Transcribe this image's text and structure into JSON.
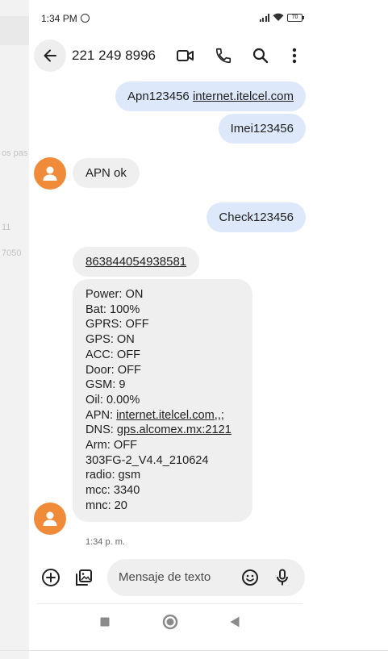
{
  "status": {
    "time": "1:34 PM",
    "battery": "70"
  },
  "header": {
    "contact": "221 249 8996"
  },
  "messages": [
    {
      "dir": "out",
      "prefix": "Apn123456 ",
      "link": "internet.itelcel.com"
    },
    {
      "dir": "out",
      "text": "Imei123456"
    },
    {
      "dir": "in",
      "text": "APN ok"
    },
    {
      "dir": "out",
      "text": "Check123456"
    },
    {
      "dir": "in",
      "link": "863844054938581"
    }
  ],
  "status_report": {
    "lines_a": "Power: ON\nBat: 100%\nGPRS: OFF\nGPS: ON\nACC: OFF\nDoor: OFF\nGSM: 9\nOil: 0.00%",
    "apn_label": "APN: ",
    "apn_link": "internet.itelcel.com,,;",
    "dns_label": "DNS: ",
    "dns_link": "gps.alcomex.mx:2121",
    "lines_b": "Arm: OFF\n303FG-2_V4.4_210624\nradio: gsm\nmcc: 3340\nmnc: 20"
  },
  "timestamp": "1:34 p. m.",
  "compose": {
    "placeholder": "Mensaje de texto"
  },
  "background": {
    "fragments": [
      "os pas",
      "11",
      "7050"
    ]
  }
}
